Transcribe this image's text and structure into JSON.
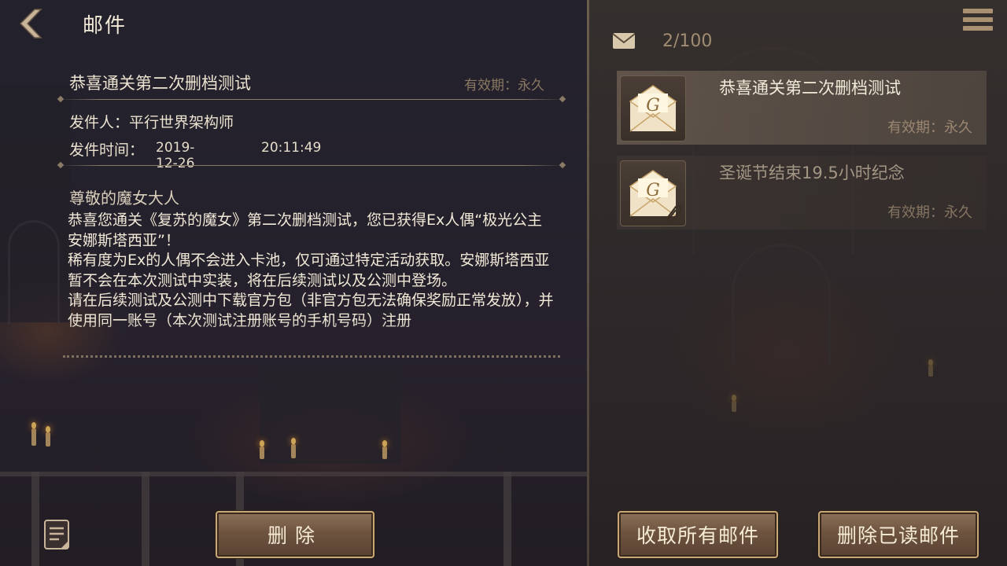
{
  "header": {
    "title": "邮件",
    "back_icon": "chevron-left-icon"
  },
  "detail": {
    "subject": "恭喜通关第二次删档测试",
    "validity": "有效期：永久",
    "sender_label": "发件人：",
    "sender": "平行世界架构师",
    "time_label": "发件时间：",
    "date": "2019-12-26",
    "time": "20:11:49",
    "greeting": "尊敬的魔女大人",
    "body": "恭喜您通关《复苏的魔女》第二次删档测试，您已获得Ex人偶“极光公主安娜斯塔西亚”！\n稀有度为Ex的人偶不会进入卡池，仅可通过特定活动获取。安娜斯塔西亚暂不会在本次测试中实装，将在后续测试以及公测中登场。\n请在后续测试及公测中下载官方包（非官方包无法确保奖励正常发放），并使用同一账号（本次测试注册账号的手机号码）注册"
  },
  "bottom_left": {
    "delete_label": "删除",
    "notes_icon": "notes-icon"
  },
  "inbox": {
    "count": "2/100",
    "envelope_icon": "envelope-icon",
    "menu_icon": "hamburger-menu-icon",
    "items": [
      {
        "title": "恭喜通关第二次删档测试",
        "validity": "有效期：永久",
        "selected": true,
        "icon": "open-letter-icon"
      },
      {
        "title": "圣诞节结束19.5小时纪念",
        "validity": "有效期：永久",
        "selected": false,
        "icon": "letter-attachment-icon"
      }
    ],
    "collect_all_label": "收取所有邮件",
    "delete_read_label": "删除已读邮件"
  },
  "colors": {
    "accent": "#c8a877",
    "text": "#f1e9d7",
    "muted": "#8a7862"
  }
}
